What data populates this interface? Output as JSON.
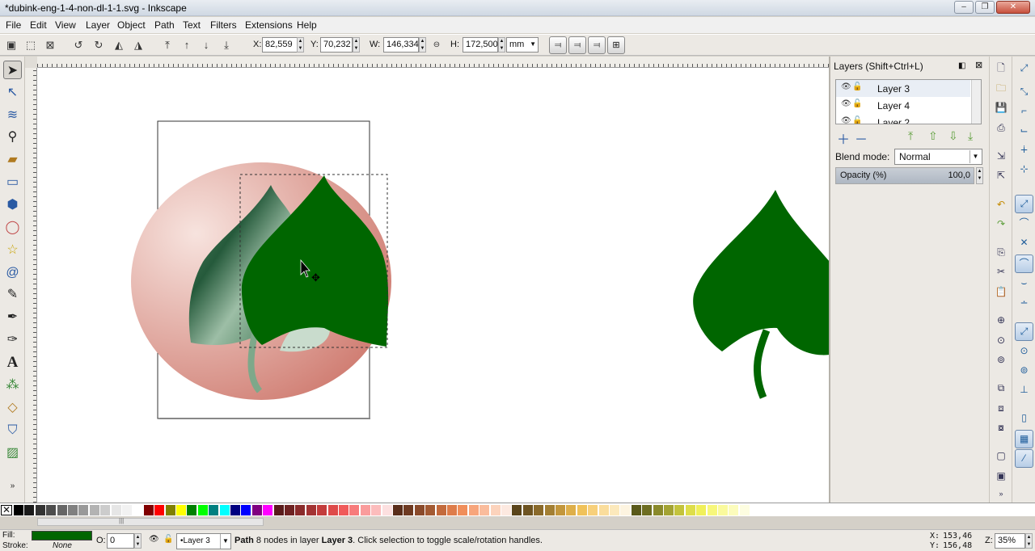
{
  "window": {
    "title": "*dubink-eng-1-4-non-dl-1-1.svg - Inkscape",
    "controls": [
      "–",
      "❐",
      "✕"
    ]
  },
  "menu": [
    "File",
    "Edit",
    "View",
    "Layer",
    "Object",
    "Path",
    "Text",
    "Filters",
    "Extensions",
    "Help"
  ],
  "toolbar": {
    "x_label": "X:",
    "x_value": "82,559",
    "y_label": "Y:",
    "y_value": "70,232",
    "w_label": "W:",
    "w_value": "146,334",
    "h_label": "H:",
    "h_value": "172,500",
    "unit": "mm"
  },
  "tools": [
    "select-tool",
    "node-tool",
    "tweak-tool",
    "zoom-tool",
    "measure-tool",
    "rect-tool",
    "3dbox-tool",
    "ellipse-tool",
    "star-tool",
    "spiral-tool",
    "pencil-tool",
    "pen-tool",
    "calligraphy-tool",
    "text-tool",
    "spray-tool",
    "eraser-tool",
    "bucket-tool",
    "gradient-tool"
  ],
  "layers_panel": {
    "header": "Layers (Shift+Ctrl+L)",
    "layers": [
      {
        "name": "Layer 3",
        "selected": true
      },
      {
        "name": "Layer 4",
        "selected": false
      },
      {
        "name": "Layer 2",
        "selected": false
      }
    ],
    "blend_label": "Blend mode:",
    "blend_value": "Normal",
    "opacity_label": "Opacity (%)",
    "opacity_value": "100,0"
  },
  "status": {
    "fill_label": "Fill:",
    "stroke_label": "Stroke:",
    "stroke_value": "None",
    "fill_color": "#006600",
    "opacity_label": "O:",
    "opacity_value": "0",
    "layer_value": "•Layer 3",
    "msg_obj": "Path",
    "msg_mid": " 8 nodes in layer ",
    "msg_layer": "Layer 3",
    "msg_end": ". Click selection to toggle scale/rotation handles.",
    "cursor_x_label": "X:",
    "cursor_x": "153,46",
    "cursor_y_label": "Y:",
    "cursor_y": "156,48",
    "zoom_label": "Z:",
    "zoom_value": "35%"
  },
  "colors": {
    "leaf": "#006600",
    "ellipse_light": "#f4d6d0",
    "ellipse_dark": "#d07f73",
    "leaf_texture": "#2f6a45"
  },
  "palette": [
    "#000000",
    "#1a1a1a",
    "#333333",
    "#4d4d4d",
    "#666666",
    "#808080",
    "#999999",
    "#b3b3b3",
    "#cccccc",
    "#e6e6e6",
    "#f2f2f2",
    "#ffffff",
    "#800000",
    "#ff0000",
    "#808000",
    "#ffff00",
    "#008000",
    "#00ff00",
    "#008080",
    "#00ffff",
    "#000080",
    "#0000ff",
    "#800080",
    "#ff00ff",
    "#5a1b1b",
    "#6e2222",
    "#8a2b2b",
    "#a33333",
    "#c33c3c",
    "#de4a4a",
    "#f05a5a",
    "#f77b7b",
    "#fa9c9c",
    "#fcbcbc",
    "#fde0e0",
    "#5a2e1b",
    "#6e3a22",
    "#8a4a2b",
    "#a35a33",
    "#c36a3c",
    "#de7c4a",
    "#f08e5a",
    "#f7a57b",
    "#fabc9c",
    "#fcd3bc",
    "#fde9e0",
    "#5a451b",
    "#6e5422",
    "#8a6a2b",
    "#a37f33",
    "#c3973c",
    "#deaf4a",
    "#f0c25a",
    "#f7d07b",
    "#fadd9c",
    "#fce9bc",
    "#fdf4e0",
    "#5a5a1b",
    "#6e6e22",
    "#8a8a2b",
    "#a3a333",
    "#c3c33c",
    "#dede4a",
    "#f0f05a",
    "#f7f77b",
    "#fafa9c",
    "#fcfcbc",
    "#fdfde0"
  ]
}
